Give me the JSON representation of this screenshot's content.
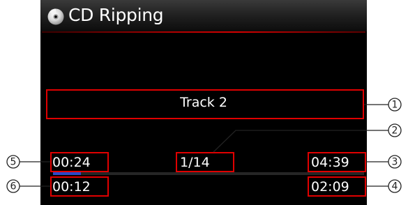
{
  "title": {
    "text": "CD Ripping",
    "icon": "cd-icon"
  },
  "track": {
    "name": "Track 2",
    "counter": "1/14"
  },
  "times": {
    "elapsed": "00:24",
    "total": "04:39",
    "rip_elapsed": "00:12",
    "rip_remaining": "02:09"
  },
  "progress": {
    "fraction": 0.09
  },
  "callouts": {
    "c1": "1",
    "c2": "2",
    "c3": "3",
    "c4": "4",
    "c5": "5",
    "c6": "6"
  },
  "colors": {
    "screen_bg": "#000000",
    "highlight_box": "#e00000",
    "progress_fill": "#2a48c8",
    "title_line": "#d40000",
    "text": "#ffffff"
  }
}
